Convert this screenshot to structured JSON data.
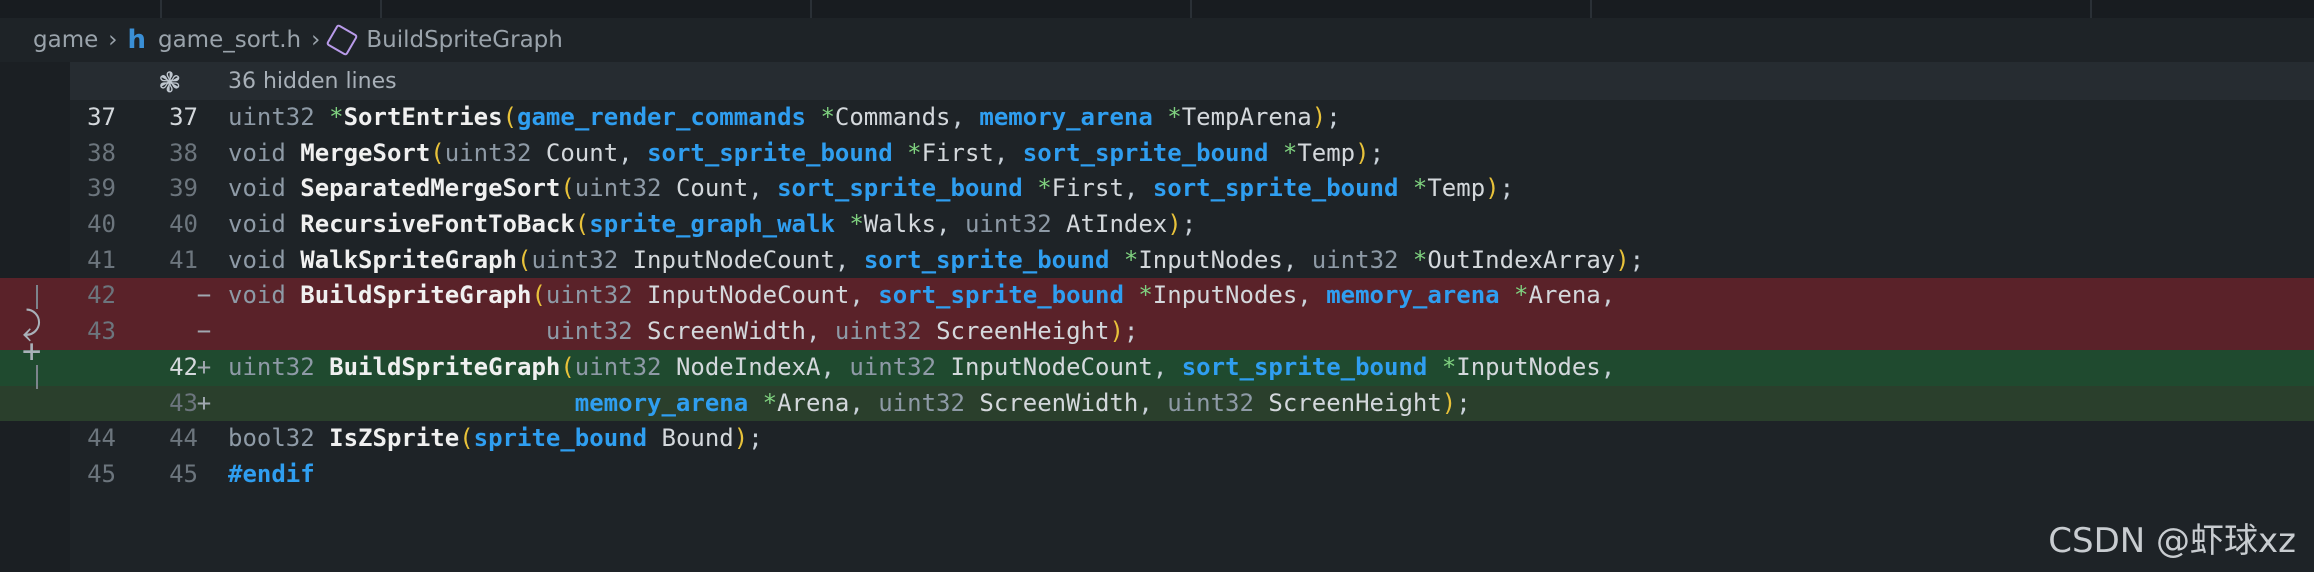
{
  "breadcrumb": {
    "folder": "game",
    "file": "game_sort.h",
    "symbol": "BuildSpriteGraph",
    "separator": ">"
  },
  "hidden_lines": "36 hidden lines",
  "lines": [
    {
      "old": "37",
      "new": "37",
      "marker": "",
      "type": "ctx",
      "cur": true,
      "text": "uint32 *SortEntries(game_render_commands *Commands, memory_arena *TempArena);"
    },
    {
      "old": "38",
      "new": "38",
      "marker": "",
      "type": "ctx",
      "text": "void MergeSort(uint32 Count, sort_sprite_bound *First, sort_sprite_bound *Temp);"
    },
    {
      "old": "39",
      "new": "39",
      "marker": "",
      "type": "ctx",
      "text": "void SeparatedMergeSort(uint32 Count, sort_sprite_bound *First, sort_sprite_bound *Temp);"
    },
    {
      "old": "40",
      "new": "40",
      "marker": "",
      "type": "ctx",
      "text": "void RecursiveFontToBack(sprite_graph_walk *Walks, uint32 AtIndex);"
    },
    {
      "old": "41",
      "new": "41",
      "marker": "",
      "type": "ctx",
      "text": "void WalkSpriteGraph(uint32 InputNodeCount, sort_sprite_bound *InputNodes, uint32 *OutIndexArray);"
    },
    {
      "old": "42",
      "new": "",
      "marker": "−",
      "type": "del",
      "text": "void BuildSpriteGraph(uint32 InputNodeCount, sort_sprite_bound *InputNodes, memory_arena *Arena,"
    },
    {
      "old": "43",
      "new": "",
      "marker": "−",
      "type": "del",
      "text": "                      uint32 ScreenWidth, uint32 ScreenHeight);"
    },
    {
      "old": "",
      "new": "42",
      "marker": "+",
      "type": "add",
      "cur": true,
      "text": "uint32 BuildSpriteGraph(uint32 NodeIndexA, uint32 InputNodeCount, sort_sprite_bound *InputNodes,"
    },
    {
      "old": "",
      "new": "43",
      "marker": "+",
      "type": "add2",
      "text": "                        memory_arena *Arena, uint32 ScreenWidth, uint32 ScreenHeight);"
    },
    {
      "old": "44",
      "new": "44",
      "marker": "",
      "type": "ctx",
      "text": "bool32 IsZSprite(sprite_bound Bound);"
    },
    {
      "old": "45",
      "new": "45",
      "marker": "",
      "type": "ctx",
      "text": "#endif"
    }
  ],
  "colors": {
    "keyword": "#8e9aa6",
    "type": "#2f9ef0",
    "func": "#f0f0f0",
    "paren": "#e8c23a",
    "param": "#d4d8dc",
    "deleted_bg": "#5a2229",
    "added_bg": "#1f4a2f"
  },
  "watermark": "CSDN @虾球xz"
}
